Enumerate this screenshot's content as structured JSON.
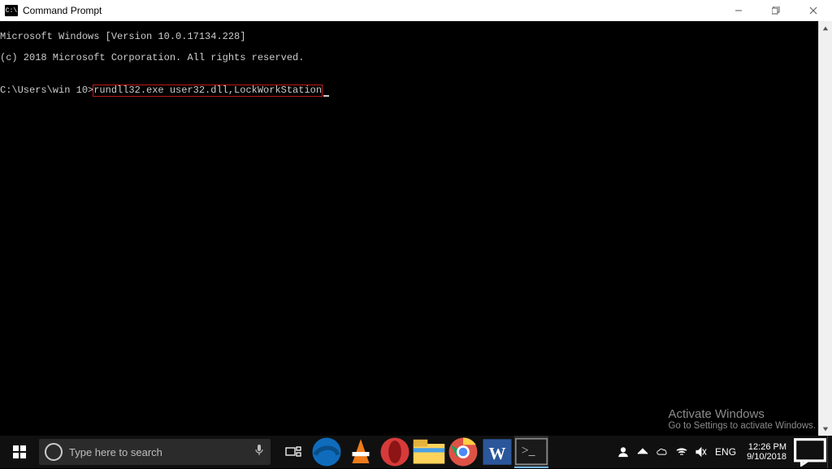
{
  "window": {
    "title": "Command Prompt",
    "icon_text": "C:\\"
  },
  "console": {
    "line1": "Microsoft Windows [Version 10.0.17134.228]",
    "line2": "(c) 2018 Microsoft Corporation. All rights reserved.",
    "blank1": "",
    "prompt": "C:\\Users\\win 10>",
    "command": "rundll32.exe user32.dll,LockWorkStation"
  },
  "activate": {
    "title": "Activate Windows",
    "subtitle": "Go to Settings to activate Windows."
  },
  "taskbar": {
    "search_placeholder": "Type here to search",
    "time": "12:26 PM",
    "date": "9/10/2018",
    "lang": "ENG"
  }
}
